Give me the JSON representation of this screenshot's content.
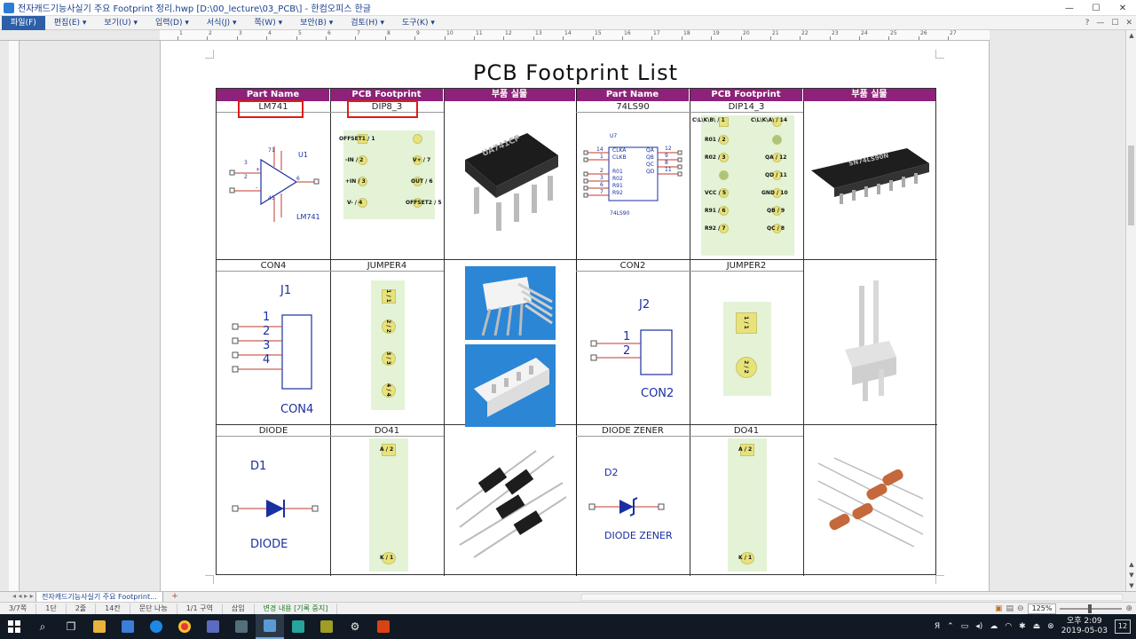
{
  "window": {
    "title": "전자캐드기능사실기 주요 Footprint 정리.hwp [D:\\00_lecture\\03_PCB\\] - 한컴오피스 한글",
    "minimize": "—",
    "maximize": "☐",
    "close": "✕"
  },
  "menu": {
    "items": [
      "파일(F)",
      "편집(E) ▾",
      "보기(U) ▾",
      "입력(D) ▾",
      "서식(J) ▾",
      "쪽(W) ▾",
      "보안(B) ▾",
      "검토(H) ▾",
      "도구(K) ▾"
    ],
    "right_controls": [
      "?",
      "—",
      "☐",
      "✕"
    ]
  },
  "ruler": {
    "numbers": [
      "1",
      "2",
      "3",
      "4",
      "5",
      "6",
      "7",
      "8",
      "9",
      "10",
      "11",
      "12",
      "13",
      "14",
      "15",
      "16",
      "17",
      "18",
      "19",
      "20",
      "21",
      "22",
      "23",
      "24",
      "25",
      "26",
      "27"
    ]
  },
  "document": {
    "title": "PCB  Footprint  List",
    "headers": [
      "Part Name",
      "PCB Footprint",
      "부품 실물",
      "Part Name",
      "PCB Footprint",
      "부품 실물"
    ],
    "rows": [
      {
        "left_name": "LM741",
        "left_fp": "DIP8_3",
        "right_name": "74LS90",
        "right_fp": "DIP14_3"
      },
      {
        "left_name": "CON4",
        "left_fp": "JUMPER4",
        "right_name": "CON2",
        "right_fp": "JUMPER2"
      },
      {
        "left_name": "DIODE",
        "left_fp": "DO41",
        "right_name": "DIODE ZENER",
        "right_fp": "DO41"
      }
    ],
    "lm741": {
      "ref": "U1",
      "value": "LM741",
      "pins": [
        "3",
        "2",
        "7",
        "4",
        "6",
        "1",
        "5"
      ],
      "pin_signs": [
        "+",
        "-"
      ]
    },
    "dip8": {
      "left_pins": [
        "OFFSET1 / 1",
        "-IN / 2",
        "+IN / 3",
        "V- / 4"
      ],
      "right_pins": [
        "V+ / 7",
        "OUT / 6",
        "OFFSET2 / 5"
      ]
    },
    "ic_label": "UA741CP",
    "ic_label2": "SN74LS90N",
    "ls90": {
      "ref": "U7",
      "value": "74LS90",
      "left_nums": [
        "14",
        "1",
        "2",
        "3",
        "6",
        "7"
      ],
      "right_nums": [
        "12",
        "9",
        "8",
        "11"
      ],
      "left_labels": [
        "CLKA",
        "CLKB",
        "R01",
        "R02",
        "R91",
        "R92"
      ],
      "right_labels": [
        "QA",
        "QB",
        "QC",
        "QD"
      ]
    },
    "dip14": {
      "top": [
        "C\\L\\K\\B\\ / 1",
        "C\\L\\K\\A\\ / 14"
      ],
      "left_pins": [
        "R01 / 2",
        "R02 / 3",
        "VCC / 5",
        "R91 / 6",
        "R92 / 7"
      ],
      "right_pins": [
        "QA / 12",
        "QD / 11",
        "GND / 10",
        "QB / 9",
        "QC / 8"
      ]
    },
    "con4": {
      "ref": "J1",
      "value": "CON4",
      "pins": [
        "1",
        "2",
        "3",
        "4"
      ]
    },
    "jumper4": {
      "pads": [
        "1 / 1",
        "2 / 2",
        "3 / 3",
        "4 / 4"
      ]
    },
    "con2": {
      "ref": "J2",
      "value": "CON2",
      "pins": [
        "1",
        "2"
      ]
    },
    "jumper2": {
      "pads": [
        "1 / 1",
        "2 / 2"
      ]
    },
    "diode": {
      "ref": "D1",
      "value": "DIODE"
    },
    "do41": {
      "top": "A / 2",
      "bottom": "K / 1"
    },
    "zener": {
      "ref": "D2",
      "value": "DIODE ZENER"
    }
  },
  "tabs": {
    "nav": "◂ ◂ ▸ ▸",
    "doc_tab": "전자캐드기능사실기 주요 Footprint...",
    "add": "+"
  },
  "status": {
    "items": [
      "3/7쪽",
      "1단",
      "2줄",
      "14칸",
      "문단 나눔",
      "1/1 구역",
      "삽입",
      "변경 내용 [기록 중지]"
    ],
    "zoom": "125%"
  },
  "taskbar": {
    "time": "오후 2:09",
    "date": "2019-05-03",
    "notification": "12",
    "ime": "Я"
  },
  "colors": {
    "header_bg": "#8e2179",
    "pad_green": "#e4f3d6",
    "pad_yellow": "#e7e27a",
    "schematic_blue": "#1a2fa0",
    "highlight_red": "#e01a1a"
  }
}
